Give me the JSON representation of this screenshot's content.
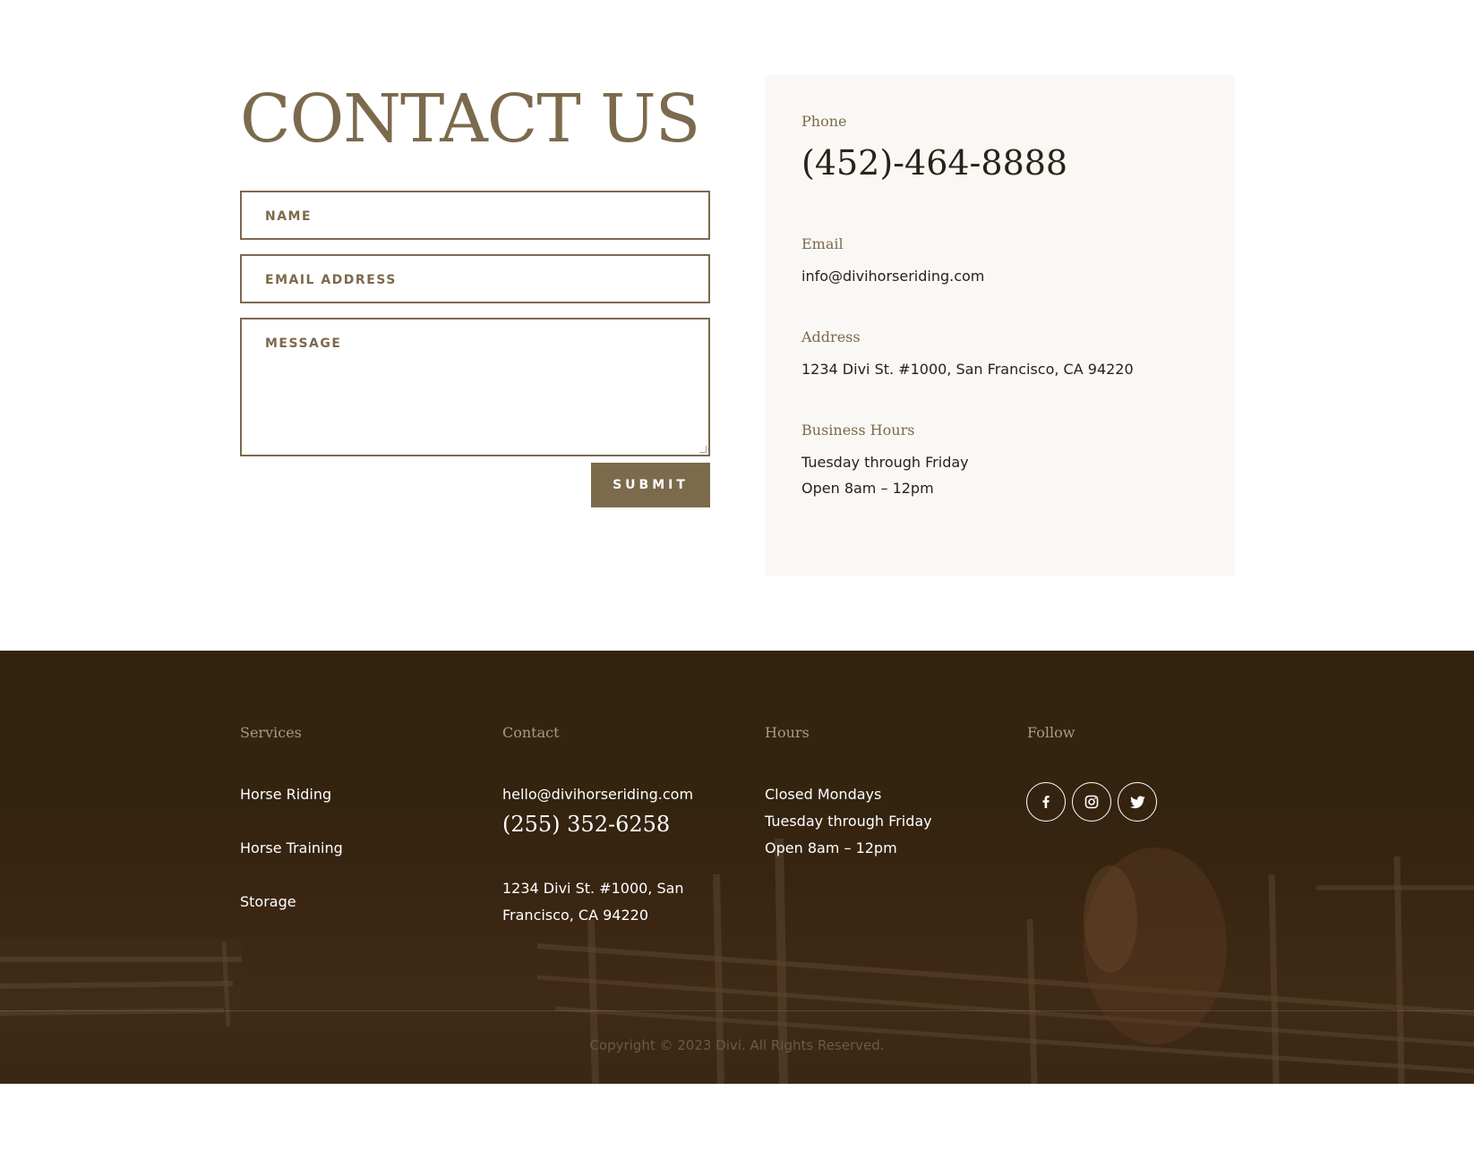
{
  "contact": {
    "title": "CONTACT US",
    "form": {
      "name_placeholder": "NAME",
      "email_placeholder": "EMAIL ADDRESS",
      "message_placeholder": "MESSAGE",
      "submit_label": "SUBMIT"
    },
    "info": {
      "phone_label": "Phone",
      "phone": "(452)-464-8888",
      "email_label": "Email",
      "email": "info@divihorseriding.com",
      "address_label": "Address",
      "address": "1234 Divi St. #1000, San Francisco, CA 94220",
      "hours_label": "Business Hours",
      "hours_line1": "Tuesday through Friday",
      "hours_line2": "Open 8am – 12pm"
    }
  },
  "footer": {
    "services": {
      "heading": "Services",
      "items": [
        "Horse Riding",
        "Horse Training",
        "Storage"
      ]
    },
    "contact": {
      "heading": "Contact",
      "email": "hello@divihorseriding.com",
      "phone": "(255) 352-6258",
      "address_line1": "1234 Divi St. #1000, San",
      "address_line2": "Francisco, CA 94220"
    },
    "hours": {
      "heading": "Hours",
      "lines": [
        "Closed Mondays",
        "Tuesday through Friday",
        "Open 8am – 12pm"
      ]
    },
    "follow": {
      "heading": "Follow",
      "icons": [
        "facebook-icon",
        "instagram-icon",
        "twitter-icon"
      ]
    },
    "copyright": "Copyright © 2023 Divi. All Rights Reserved."
  },
  "colors": {
    "accent": "#7b6a4c",
    "footer_bg": "#33230d",
    "card_bg": "#faf8f5"
  }
}
